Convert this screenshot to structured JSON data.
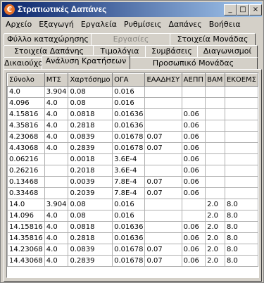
{
  "window": {
    "title": "Στρατιωτικές Δαπάνες",
    "icon": "euro-icon",
    "accent": "#0a246a",
    "controls": [
      "_",
      "□",
      "×"
    ]
  },
  "menu": [
    "Αρχείο",
    "Εξαγωγή",
    "Εργαλεία",
    "Ρυθμίσεις",
    "Δαπάνες",
    "Βοήθεια"
  ],
  "tabs": {
    "row1": [
      {
        "label": "Φύλλο καταχώρησης",
        "disabled": false
      },
      {
        "label": "Εργασίες",
        "disabled": true
      },
      {
        "label": "Στοιχεία Μονάδας",
        "disabled": false
      }
    ],
    "row2": [
      {
        "label": "Στοιχεία Δαπάνης"
      },
      {
        "label": "Τιμολόγια"
      },
      {
        "label": "Συμβάσεις"
      },
      {
        "label": "Διαγωνισμοί"
      }
    ],
    "row3": [
      {
        "label": "Δικαιούχοι"
      },
      {
        "label": "Ανάλυση Κρατήσεων",
        "active": true
      },
      {
        "label": "Προσωπικό Μονάδας"
      }
    ]
  },
  "table": {
    "columns": [
      "Σύνολο",
      "ΜΤΣ",
      "Χαρτόσημο",
      "ΟΓΑ",
      "ΕΑΑΔΗΣΥ",
      "ΑΕΠΠ",
      "ΒΑΜ",
      "ΕΚΟΕΜΣ"
    ],
    "rows": [
      [
        "4.0",
        "3.904",
        "0.08",
        "0.016",
        "",
        "",
        "",
        ""
      ],
      [
        "4.096",
        "4.0",
        "0.08",
        "0.016",
        "",
        "",
        "",
        ""
      ],
      [
        "4.15816",
        "4.0",
        "0.0818",
        "0.01636",
        "",
        "0.06",
        "",
        ""
      ],
      [
        "4.35816",
        "4.0",
        "0.2818",
        "0.01636",
        "",
        "0.06",
        "",
        ""
      ],
      [
        "4.23068",
        "4.0",
        "0.0839",
        "0.01678",
        "0.07",
        "0.06",
        "",
        ""
      ],
      [
        "4.43068",
        "4.0",
        "0.2839",
        "0.01678",
        "0.07",
        "0.06",
        "",
        ""
      ],
      [
        "0.06216",
        "",
        "0.0018",
        "3.6E-4",
        "",
        "0.06",
        "",
        ""
      ],
      [
        "0.26216",
        "",
        "0.2018",
        "3.6E-4",
        "",
        "0.06",
        "",
        ""
      ],
      [
        "0.13468",
        "",
        "0.0039",
        "7.8E-4",
        "0.07",
        "0.06",
        "",
        ""
      ],
      [
        "0.33468",
        "",
        "0.2039",
        "7.8E-4",
        "0.07",
        "0.06",
        "",
        ""
      ],
      [
        "14.0",
        "3.904",
        "0.08",
        "0.016",
        "",
        "",
        "2.0",
        "8.0"
      ],
      [
        "14.096",
        "4.0",
        "0.08",
        "0.016",
        "",
        "",
        "2.0",
        "8.0"
      ],
      [
        "14.15816",
        "4.0",
        "0.0818",
        "0.01636",
        "",
        "0.06",
        "2.0",
        "8.0"
      ],
      [
        "14.35816",
        "4.0",
        "0.2818",
        "0.01636",
        "",
        "0.06",
        "2.0",
        "8.0"
      ],
      [
        "14.23068",
        "4.0",
        "0.0839",
        "0.01678",
        "0.07",
        "0.06",
        "2.0",
        "8.0"
      ],
      [
        "14.43068",
        "4.0",
        "0.2839",
        "0.01678",
        "0.07",
        "0.06",
        "2.0",
        "8.0"
      ]
    ]
  }
}
